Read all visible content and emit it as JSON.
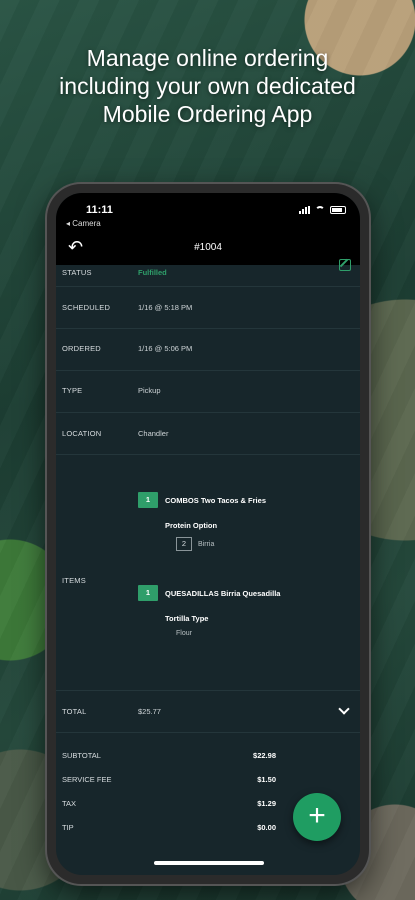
{
  "headline": {
    "line1": "Manage online ordering",
    "line2": "including your own dedicated",
    "line3": "Mobile Ordering App"
  },
  "statusbar": {
    "time": "11:11",
    "back_app": "◂ Camera"
  },
  "navbar": {
    "title": "#1004",
    "back_icon": "undo-icon"
  },
  "order": {
    "status_label": "STATUS",
    "status_value": "Fulfilled",
    "scheduled_label": "SCHEDULED",
    "scheduled_value": "1/16 @ 5:18 PM",
    "ordered_label": "ORDERED",
    "ordered_value": "1/16 @ 5:06 PM",
    "type_label": "TYPE",
    "type_value": "Pickup",
    "location_label": "LOCATION",
    "location_value": "Chandler",
    "items_label": "ITEMS",
    "items": [
      {
        "qty": "1",
        "name": "COMBOS Two Tacos & Fries",
        "option_title": "Protein Option",
        "sub_qty": "2",
        "sub_name": "Birria"
      },
      {
        "qty": "1",
        "name": "QUESADILLAS Birria Quesadilla",
        "option_title": "Tortilla Type",
        "sub_name": "Flour"
      }
    ],
    "total_label": "TOTAL",
    "total_value": "$25.77",
    "subtotal_label": "SUBTOTAL",
    "subtotal_value": "$22.98",
    "service_fee_label": "SERVICE FEE",
    "service_fee_value": "$1.50",
    "tax_label": "TAX",
    "tax_value": "$1.29",
    "tip_label": "TIP",
    "tip_value": "$0.00"
  },
  "fab": {
    "label": "+"
  },
  "colors": {
    "accent": "#1f9d62",
    "screen_bg": "#17262b"
  }
}
